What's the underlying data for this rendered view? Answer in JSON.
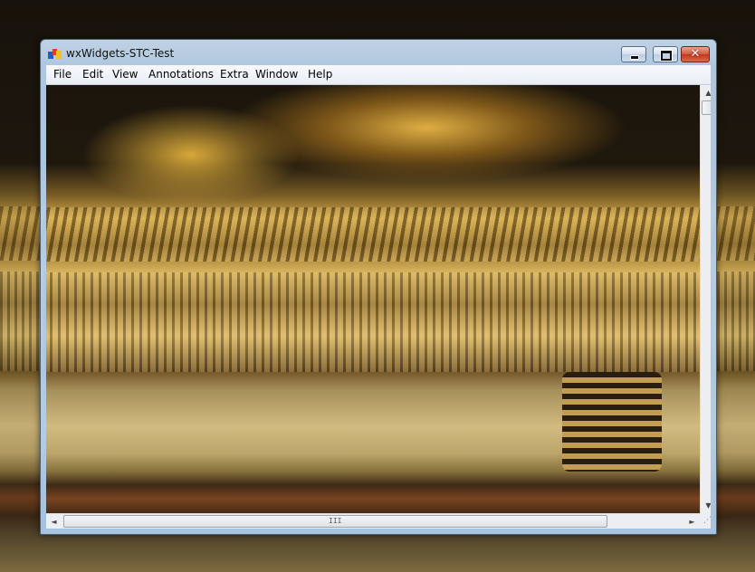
{
  "window": {
    "title": "wxWidgets-STC-Test",
    "icon": "wx-app-icon"
  },
  "caption_buttons": {
    "minimize": "minimize-icon",
    "maximize": "maximize-icon",
    "close": "close-icon",
    "close_glyph": "✕"
  },
  "menu": {
    "items": [
      "File",
      "Edit",
      "View",
      "Annotations",
      "Extra",
      "Window",
      "Help"
    ]
  },
  "scrollbars": {
    "up_arrow": "▲",
    "down_arrow": "▼",
    "left_arrow": "◄",
    "right_arrow": "►",
    "grip": "III",
    "size_grip": "⋰"
  },
  "colors": {
    "close_button": "#c0361c",
    "frame": "#b9d4ee"
  }
}
